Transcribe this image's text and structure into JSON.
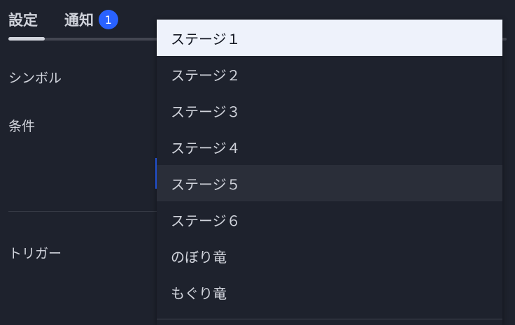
{
  "tabs": [
    {
      "label": "設定"
    },
    {
      "label": "通知",
      "badge": "1"
    }
  ],
  "form": {
    "symbol_label": "シンボル",
    "condition_label": "条件",
    "trigger_label": "トリガー"
  },
  "dropdown": {
    "selected_index": 0,
    "hovered_index": 4,
    "options": [
      {
        "label": "ステージ１"
      },
      {
        "label": "ステージ２"
      },
      {
        "label": "ステージ３"
      },
      {
        "label": "ステージ４"
      },
      {
        "label": "ステージ５"
      },
      {
        "label": "ステージ６"
      },
      {
        "label": "のぼり竜"
      },
      {
        "label": "もぐり竜"
      }
    ]
  },
  "colors": {
    "background": "#1e222d",
    "accent": "#2962ff",
    "text": "#d1d4dc",
    "selected_background": "#eef2fb",
    "hover_background": "#2a2e39"
  }
}
